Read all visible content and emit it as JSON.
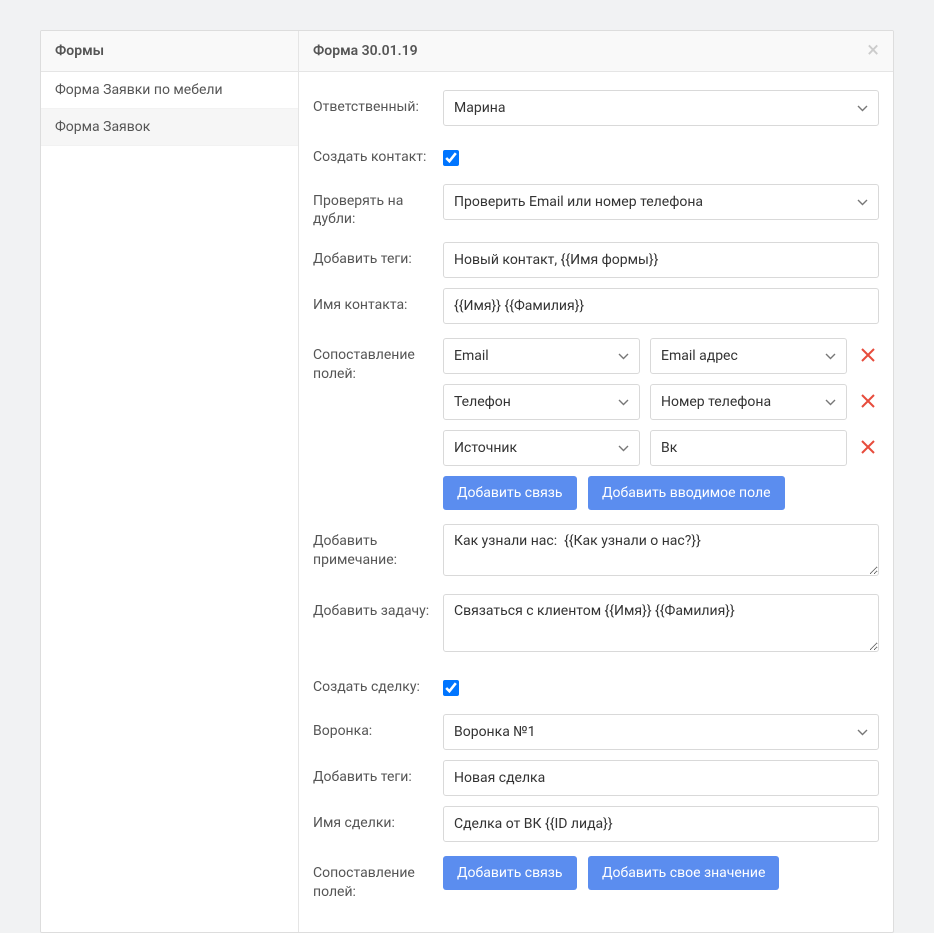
{
  "header": {
    "left_title": "Формы",
    "right_title": "Форма 30.01.19"
  },
  "sidebar": {
    "items": [
      {
        "label": "Форма Заявки по мебели",
        "active": false
      },
      {
        "label": "Форма Заявок",
        "active": true
      }
    ]
  },
  "form": {
    "responsible": {
      "label": "Ответственный:",
      "value": "Марина"
    },
    "create_contact": {
      "label": "Создать контакт:",
      "checked": true
    },
    "check_dupes": {
      "label": "Проверять на дубли:",
      "value": "Проверить Email или номер телефона"
    },
    "add_tags": {
      "label": "Добавить теги:",
      "value": "Новый контакт, {{Имя формы}}"
    },
    "contact_name": {
      "label": "Имя контакта:",
      "value": "{{Имя}} {{Фамилия}}"
    },
    "mapping": {
      "label": "Сопоставление полей:",
      "rows": [
        {
          "left": "Email",
          "right": "Email адрес",
          "right_type": "select"
        },
        {
          "left": "Телефон",
          "right": "Номер телефона",
          "right_type": "select"
        },
        {
          "left": "Источник",
          "right": "Вк",
          "right_type": "text"
        }
      ],
      "btn_add_link": "Добавить связь",
      "btn_add_input": "Добавить вводимое поле"
    },
    "add_note": {
      "label": "Добавить примечание:",
      "value": "Как узнали нас:  {{Как узнали о нас?}}"
    },
    "add_task": {
      "label": "Добавить задачу:",
      "value": "Связаться с клиентом {{Имя}} {{Фамилия}}"
    },
    "create_deal": {
      "label": "Создать сделку:",
      "checked": true
    },
    "funnel": {
      "label": "Воронка:",
      "value": "Воронка №1"
    },
    "deal_tags": {
      "label": "Добавить теги:",
      "value": "Новая сделка"
    },
    "deal_name": {
      "label": "Имя сделки:",
      "value": "Сделка от ВК {{ID лида}}"
    },
    "deal_mapping": {
      "label": "Сопоставление полей:",
      "btn_add_link": "Добавить связь",
      "btn_add_value": "Добавить свое значение"
    }
  }
}
